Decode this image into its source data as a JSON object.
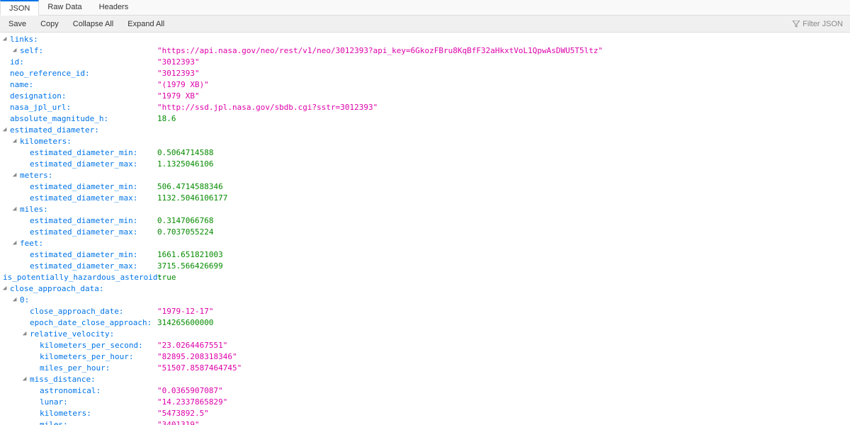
{
  "tabs": {
    "json": "JSON",
    "raw": "Raw Data",
    "headers": "Headers"
  },
  "toolbar": {
    "save": "Save",
    "copy": "Copy",
    "collapse": "Collapse All",
    "expand": "Expand All",
    "filter_placeholder": "Filter JSON"
  },
  "k": {
    "links": "links",
    "self": "self",
    "id": "id",
    "neo_reference_id": "neo_reference_id",
    "name": "name",
    "designation": "designation",
    "nasa_jpl_url": "nasa_jpl_url",
    "absolute_magnitude_h": "absolute_magnitude_h",
    "estimated_diameter": "estimated_diameter",
    "kilometers": "kilometers",
    "meters": "meters",
    "miles": "miles",
    "feet": "feet",
    "estimated_diameter_min": "estimated_diameter_min",
    "estimated_diameter_max": "estimated_diameter_max",
    "is_potentially_hazardous_asteroid": "is_potentially_hazardous_asteroid",
    "close_approach_data": "close_approach_data",
    "zero": "0",
    "close_approach_date": "close_approach_date",
    "epoch_date_close_approach": "epoch_date_close_approach",
    "relative_velocity": "relative_velocity",
    "kilometers_per_second": "kilometers_per_second",
    "kilometers_per_hour": "kilometers_per_hour",
    "miles_per_hour": "miles_per_hour",
    "miss_distance": "miss_distance",
    "astronomical": "astronomical",
    "lunar": "lunar"
  },
  "v": {
    "self_url": "\"https://api.nasa.gov/neo/rest/v1/neo/3012393?api_key=6GkozFBru8KqBfF32aHkxtVoL1QpwAsDWU5T5ltz\"",
    "id": "\"3012393\"",
    "neo_ref": "\"3012393\"",
    "name": "\"(1979 XB)\"",
    "designation": "\"1979 XB\"",
    "jpl_url": "\"http://ssd.jpl.nasa.gov/sbdb.cgi?sstr=3012393\"",
    "abs_mag": "18.6",
    "km_min": "0.5064714588",
    "km_max": "1.1325046106",
    "m_min": "506.4714588346",
    "m_max": "1132.5046106177",
    "mi_min": "0.3147066768",
    "mi_max": "0.7037055224",
    "ft_min": "1661.651821003",
    "ft_max": "3715.566426699",
    "haz": "true",
    "cad": "\"1979-12-17\"",
    "epoch": "314265600000",
    "kps": "\"23.0264467551\"",
    "kph": "\"82895.208318346\"",
    "mph": "\"51507.8587464745\"",
    "au": "\"0.0365907087\"",
    "lunar": "\"14.2337865829\"",
    "km_dist": "\"5473892.5\"",
    "mi_dist": "\"3401319\""
  }
}
